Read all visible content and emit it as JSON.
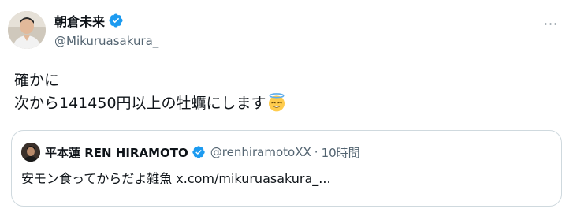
{
  "author": {
    "display_name": "朝倉未来",
    "handle": "@Mikuruasakura_",
    "avatar_icon": "person-avatar",
    "verified_icon": "verified-badge-icon"
  },
  "menu": {
    "more_label": "···"
  },
  "tweet": {
    "lines": [
      "確かに",
      "次から141450円以上の牡蠣にします"
    ],
    "emoji": "smiling-face-with-halo-emoji"
  },
  "quote": {
    "display_name": "平本蓮 REN HIRAMOTO",
    "handle": "@renhiramotoXX",
    "separator": "·",
    "time": "10時間",
    "text": "安モン食ってからだよ雑魚 x.com/mikuruasakura_...",
    "avatar_icon": "person-avatar",
    "verified_icon": "verified-badge-icon"
  },
  "colors": {
    "text": "#0f1419",
    "secondary": "#536471",
    "verified": "#1d9bf0",
    "border": "#cfd9de"
  }
}
